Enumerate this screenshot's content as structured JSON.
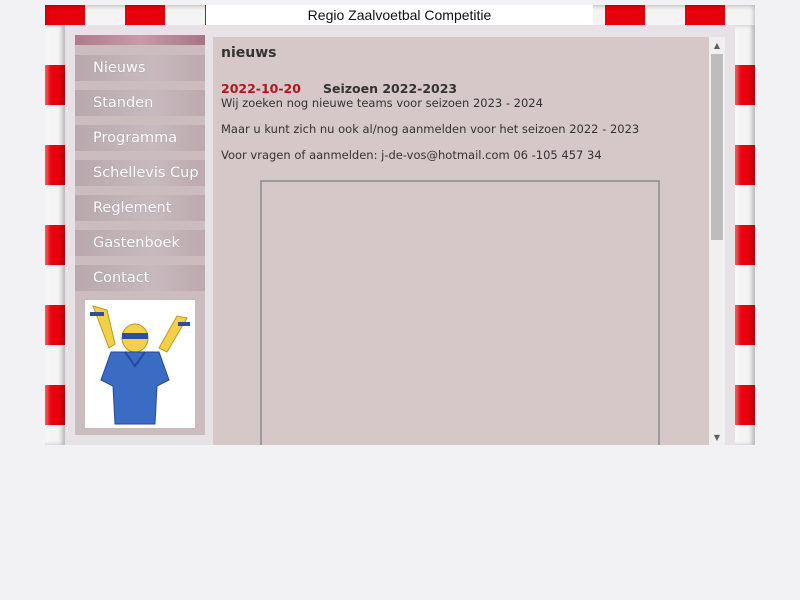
{
  "header": {
    "title": "Regio Zaalvoetbal Competitie"
  },
  "nav": {
    "items": [
      {
        "label": "Nieuws"
      },
      {
        "label": "Standen"
      },
      {
        "label": "Programma"
      },
      {
        "label": "Schellevis Cup"
      },
      {
        "label": "Reglement"
      },
      {
        "label": "Gastenboek"
      },
      {
        "label": "Contact"
      }
    ]
  },
  "content": {
    "heading": "nieuws",
    "news": {
      "date": "2022-10-20",
      "title": "Seizoen 2022-2023",
      "line1": "Wij zoeken nog nieuwe teams voor seizoen 2023 - 2024",
      "line2": "Maar u kunt zich nu ook al/nog aanmelden voor het seizoen 2022 - 2023",
      "line3": "Voor vragen of aanmelden: j-de-vos@hotmail.com 06 -105 457 34"
    }
  },
  "scrollbar": {
    "up_icon": "▲",
    "down_icon": "▼"
  },
  "colors": {
    "post_red": "#e8000c",
    "date_red": "#b3141e",
    "content_bg": "#d6c7c8",
    "sidebar_bg": "#cbbcc0"
  }
}
